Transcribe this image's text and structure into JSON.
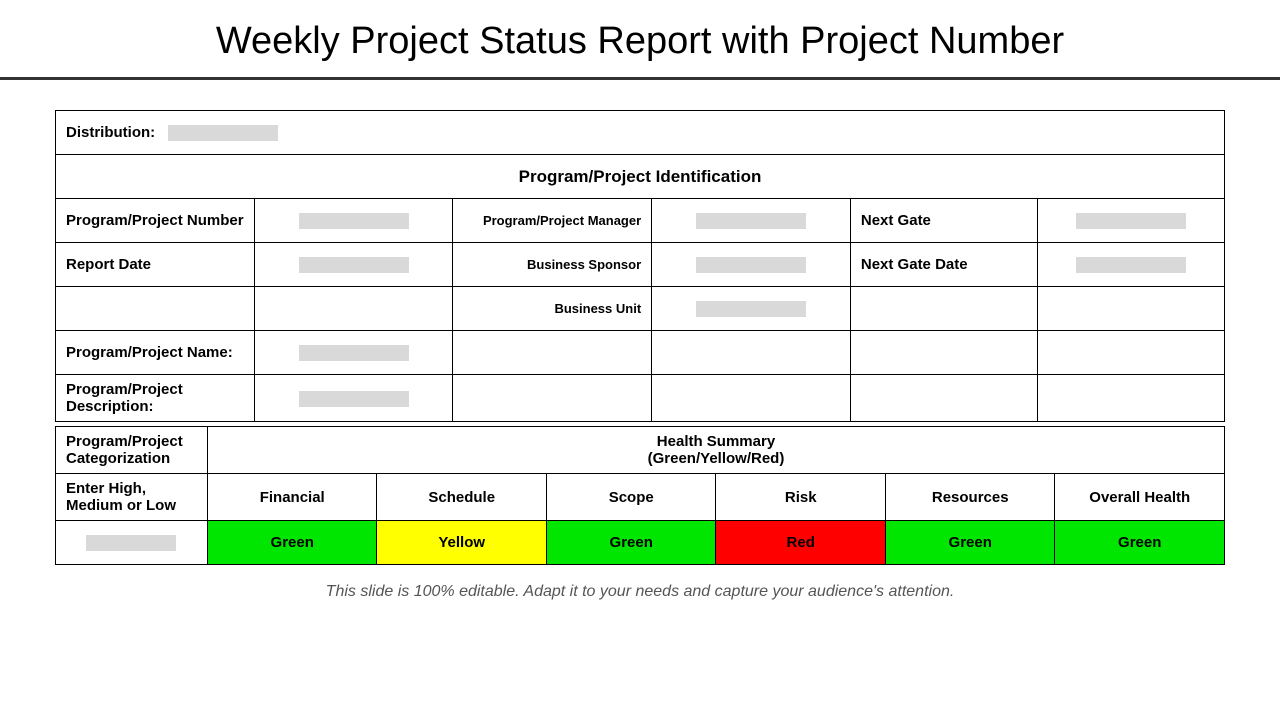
{
  "title": "Weekly Project Status Report with Project Number",
  "distribution_label": "Distribution:",
  "identification_header": "Program/Project Identification",
  "id_rows": {
    "r1": {
      "c1": "Program/Project Number",
      "c3": "Program/Project Manager",
      "c5": "Next Gate"
    },
    "r2": {
      "c1": "Report Date",
      "c3": "Business Sponsor",
      "c5": "Next Gate Date"
    },
    "r3": {
      "c1": "",
      "c3": "Business Unit",
      "c5": ""
    },
    "r4": {
      "c1": "Program/Project Name:"
    },
    "r5": {
      "c1": "Program/Project Description:"
    }
  },
  "health": {
    "categorization_label": "Program/Project Categorization",
    "summary_header_line1": "Health Summary",
    "summary_header_line2": "(Green/Yellow/Red)",
    "enter_label": "Enter High, Medium or Low",
    "columns": [
      "Financial",
      "Schedule",
      "Scope",
      "Risk",
      "Resources",
      "Overall Health"
    ],
    "values": [
      {
        "text": "Green",
        "color": "green"
      },
      {
        "text": "Yellow",
        "color": "yellow"
      },
      {
        "text": "Green",
        "color": "green"
      },
      {
        "text": "Red",
        "color": "red"
      },
      {
        "text": "Green",
        "color": "green"
      },
      {
        "text": "Green",
        "color": "green"
      }
    ]
  },
  "footnote": "This slide is 100% editable. Adapt it to your needs and capture your audience's attention."
}
